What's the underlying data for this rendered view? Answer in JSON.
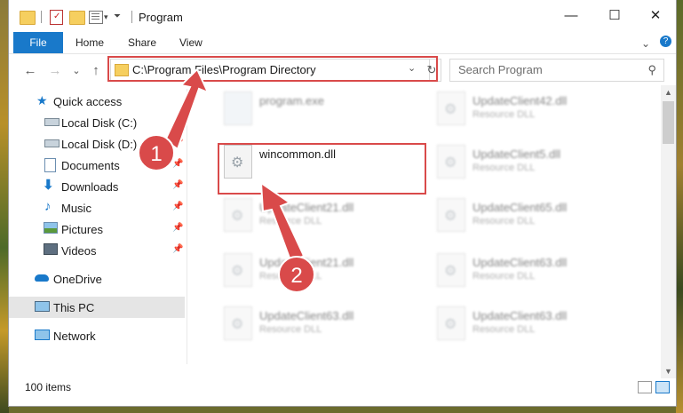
{
  "window": {
    "title": "Program",
    "controls": {
      "minimize": "—",
      "maximize": "☐",
      "close": "✕"
    }
  },
  "ribbon": {
    "file": "File",
    "tabs": [
      "Home",
      "Share",
      "View"
    ],
    "expand_glyph": "⌄",
    "help_glyph": "?"
  },
  "navigation": {
    "back": "←",
    "forward": "→",
    "recent": "⌄",
    "up": "↑",
    "address": "C:\\Program Files\\Program Directory",
    "address_chevron": "⌄",
    "refresh": "↻",
    "search_placeholder": "Search Program",
    "search_glyph": "⚲"
  },
  "sidebar": {
    "items": [
      {
        "label": "Quick access",
        "icon": "star-icon"
      },
      {
        "label": "Local Disk (C:)",
        "icon": "drive-icon"
      },
      {
        "label": "Local Disk (D:)",
        "icon": "drive-icon"
      },
      {
        "label": "Documents",
        "icon": "documents-icon"
      },
      {
        "label": "Downloads",
        "icon": "download-icon"
      },
      {
        "label": "Music",
        "icon": "music-icon"
      },
      {
        "label": "Pictures",
        "icon": "pictures-icon"
      },
      {
        "label": "Videos",
        "icon": "videos-icon"
      },
      {
        "label": "OneDrive",
        "icon": "cloud-icon"
      },
      {
        "label": "This PC",
        "icon": "computer-icon"
      },
      {
        "label": "Network",
        "icon": "network-icon"
      }
    ],
    "pin_glyph": "📌"
  },
  "files": {
    "items": [
      {
        "name": "program.exe",
        "type": ""
      },
      {
        "name": "UpdateClient42.dll",
        "type": "Resource DLL"
      },
      {
        "name": "wincommon.dll",
        "type": ""
      },
      {
        "name": "UpdateClient5.dll",
        "type": "Resource DLL"
      },
      {
        "name": "UpdateClient21.dll",
        "type": "Resource DLL"
      },
      {
        "name": "UpdateClient65.dll",
        "type": "Resource DLL"
      },
      {
        "name": "UpdateClient21.dll",
        "type": "Resource DLL"
      },
      {
        "name": "UpdateClient63.dll",
        "type": "Resource DLL"
      },
      {
        "name": "UpdateClient63.dll",
        "type": "Resource DLL"
      },
      {
        "name": "UpdateClient63.dll",
        "type": "Resource DLL"
      }
    ],
    "gear_glyph": "⚙"
  },
  "status": {
    "count": "100 items"
  },
  "annotations": {
    "step1": "1",
    "step2": "2",
    "highlight_color": "#d94a4a",
    "badge_color": "#d94a4a"
  }
}
